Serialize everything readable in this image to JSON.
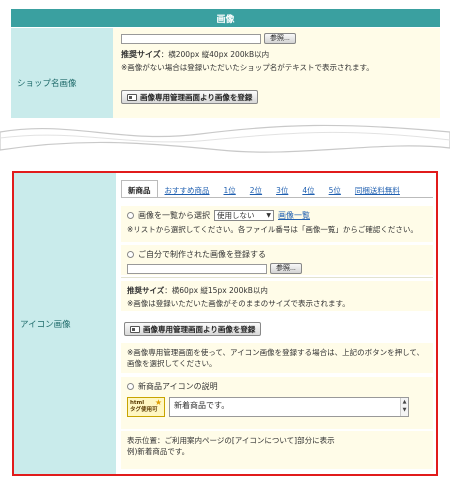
{
  "top": {
    "header": "画像",
    "label": "ショップ名画像",
    "browse_label": "参照...",
    "recommended_title": "推奨サイズ",
    "recommended_text": "：横200px 縦40px 200kB以内",
    "note": "※画像がない場合は登録いただいたショップ名がテキストで表示されます。",
    "register_button": "画像専用管理画面より画像を登録"
  },
  "icon_section": {
    "label": "アイコン画像",
    "tabs": [
      "新商品",
      "おすすめ商品",
      "1位",
      "2位",
      "3位",
      "4位",
      "5位",
      "同梱送料無料"
    ],
    "active_tab": 0,
    "select_from_list_label": "画像を一覧から選択",
    "select_value": "使用しない",
    "image_list_link": "画像一覧",
    "list_note": "※リストから選択してください。各ファイル番号は「画像一覧」からご確認ください。",
    "own_image_label": "ご自分で制作された画像を登録する",
    "browse_label": "参照...",
    "recommended_title": "推奨サイズ",
    "recommended_text": "：横60px 縦15px 200kB以内",
    "recommended_note": "※画像は登録いただいた画像がそのままのサイズで表示されます。",
    "register_button": "画像専用管理画面より画像を登録",
    "manage_note": "※画像専用管理画面を使って、アイコン画像を登録する場合は、上記のボタンを押して、画像を選択してください。",
    "desc_label": "新商品アイコンの説明",
    "html_badge_line1": "html",
    "html_badge_line2": "タグ使用可",
    "desc_value": "新着商品です。",
    "display_position": "表示位置：ご利用案内ページの[アイコンについて]部分に表示",
    "example": "例)新着商品です。"
  },
  "colors": {
    "header_teal": "#3aa0a0",
    "label_bg": "#c9ebeb",
    "panel_bg": "#fffce8",
    "highlight_border": "#e11b1b"
  }
}
